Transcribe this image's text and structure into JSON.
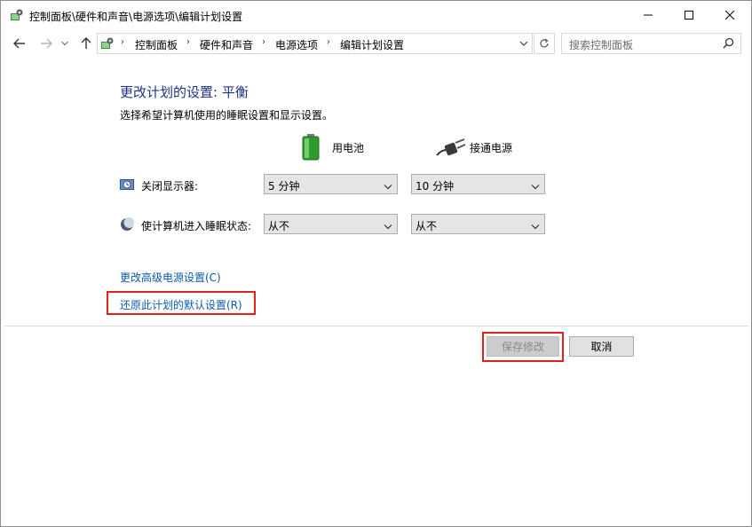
{
  "window": {
    "title": "控制面板\\硬件和声音\\电源选项\\编辑计划设置"
  },
  "address_bar": {
    "breadcrumbs": [
      "控制面板",
      "硬件和声音",
      "电源选项",
      "编辑计划设置"
    ],
    "separator": "›"
  },
  "search": {
    "placeholder": "搜索控制面板"
  },
  "main": {
    "heading": "更改计划的设置: 平衡",
    "subtext": "选择希望计算机使用的睡眠设置和显示设置。",
    "columns": {
      "battery": "用电池",
      "plugged_in": "接通电源"
    },
    "rows": {
      "display_off": {
        "label": "关闭显示器:",
        "battery_value": "5 分钟",
        "plugged_value": "10 分钟"
      },
      "sleep": {
        "label": "使计算机进入睡眠状态:",
        "battery_value": "从不",
        "plugged_value": "从不"
      }
    },
    "links": {
      "advanced": "更改高级电源设置(C)",
      "restore": "还原此计划的默认设置(R)"
    }
  },
  "buttons": {
    "save": "保存修改",
    "cancel": "取消"
  },
  "colors": {
    "heading": "#1e3287",
    "link": "#0b5cad",
    "highlight": "#e0211c"
  }
}
